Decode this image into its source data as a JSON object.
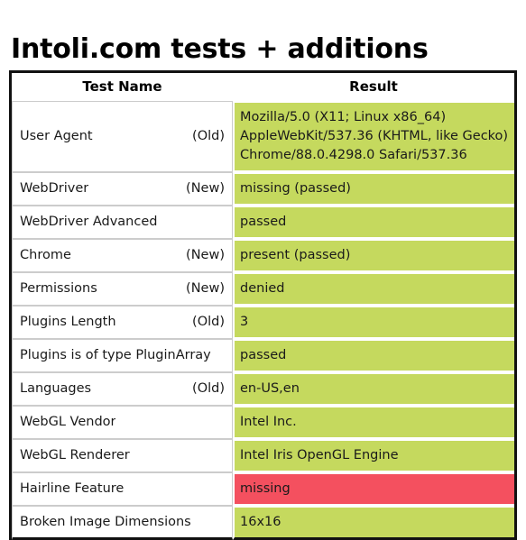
{
  "page": {
    "title": "Intoli.com tests + additions"
  },
  "table": {
    "headers": {
      "test_name": "Test Name",
      "result": "Result"
    },
    "rows": [
      {
        "name": "User Agent",
        "age": "(Old)",
        "result": "Mozilla/5.0 (X11; Linux x86_64) AppleWebKit/537.36 (KHTML, like Gecko) Chrome/88.0.4298.0 Safari/537.36",
        "status": "pass"
      },
      {
        "name": "WebDriver",
        "age": "(New)",
        "result": "missing (passed)",
        "status": "pass"
      },
      {
        "name": "WebDriver Advanced",
        "age": "",
        "result": "passed",
        "status": "pass"
      },
      {
        "name": "Chrome",
        "age": "(New)",
        "result": "present (passed)",
        "status": "pass"
      },
      {
        "name": "Permissions",
        "age": "(New)",
        "result": "denied",
        "status": "pass"
      },
      {
        "name": "Plugins Length",
        "age": "(Old)",
        "result": "3",
        "status": "pass"
      },
      {
        "name": "Plugins is of type PluginArray",
        "age": "",
        "result": "passed",
        "status": "pass"
      },
      {
        "name": "Languages",
        "age": "(Old)",
        "result": "en-US,en",
        "status": "pass"
      },
      {
        "name": "WebGL Vendor",
        "age": "",
        "result": "Intel Inc.",
        "status": "pass"
      },
      {
        "name": "WebGL Renderer",
        "age": "",
        "result": "Intel Iris OpenGL Engine",
        "status": "pass"
      },
      {
        "name": "Hairline Feature",
        "age": "",
        "result": "missing",
        "status": "fail"
      },
      {
        "name": "Broken Image Dimensions",
        "age": "",
        "result": "16x16",
        "status": "pass"
      }
    ]
  },
  "colors": {
    "pass": "#c5d95e",
    "fail": "#f4505f",
    "border": "#111111",
    "cell_border": "#cccccc",
    "text": "#1a1a1a",
    "background": "#ffffff"
  }
}
